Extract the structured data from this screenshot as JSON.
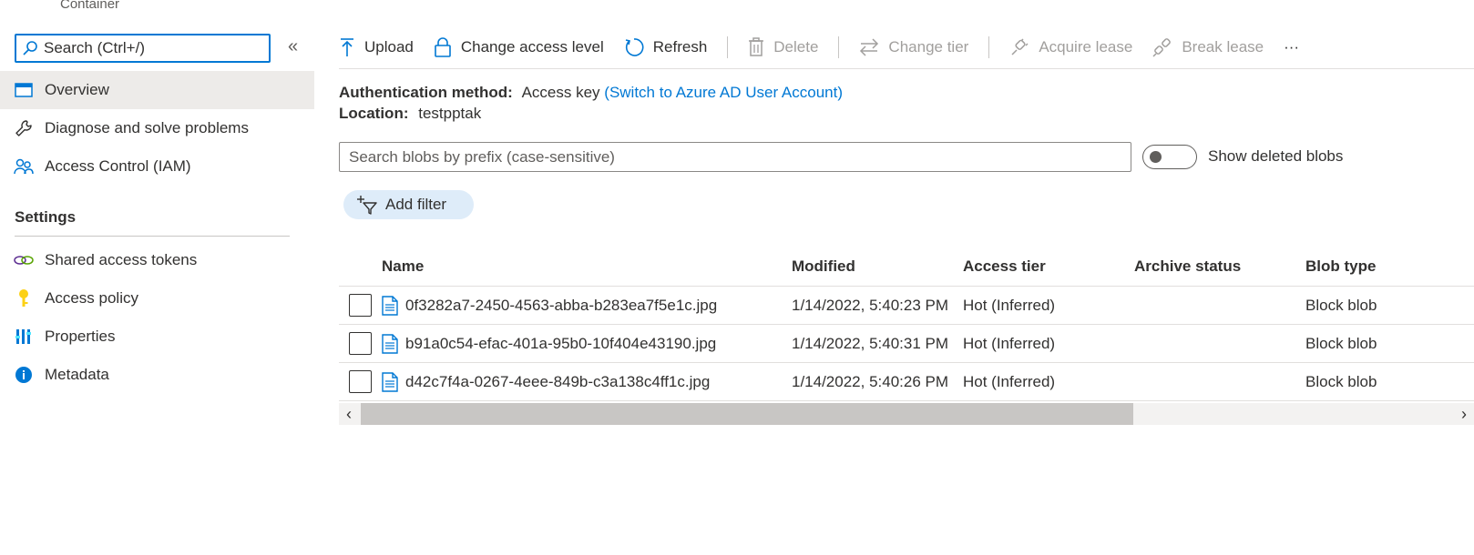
{
  "header": {
    "subtitle": "Container"
  },
  "sidebar": {
    "search_placeholder": "Search (Ctrl+/)",
    "collapse_glyph": "«",
    "items": [
      {
        "label": "Overview",
        "icon": "overview-icon",
        "selected": true
      },
      {
        "label": "Diagnose and solve problems",
        "icon": "wrench-icon"
      },
      {
        "label": "Access Control (IAM)",
        "icon": "people-icon"
      }
    ],
    "settings_label": "Settings",
    "settings_items": [
      {
        "label": "Shared access tokens",
        "icon": "link-chain-icon"
      },
      {
        "label": "Access policy",
        "icon": "key-icon"
      },
      {
        "label": "Properties",
        "icon": "properties-bars-icon"
      },
      {
        "label": "Metadata",
        "icon": "info-icon"
      }
    ]
  },
  "toolbar": {
    "upload": "Upload",
    "change_access_level": "Change access level",
    "refresh": "Refresh",
    "delete": "Delete",
    "change_tier": "Change tier",
    "acquire_lease": "Acquire lease",
    "break_lease": "Break lease",
    "more": "···"
  },
  "auth": {
    "method_label": "Authentication method:",
    "method_value": "Access key",
    "switch_link": "(Switch to Azure AD User Account)",
    "location_label": "Location:",
    "location_value": "testpptak"
  },
  "blob_search": {
    "placeholder": "Search blobs by prefix (case-sensitive)"
  },
  "show_deleted": {
    "label": "Show deleted blobs",
    "on": false
  },
  "filter": {
    "label": "Add filter"
  },
  "table": {
    "columns": [
      "Name",
      "Modified",
      "Access tier",
      "Archive status",
      "Blob type"
    ],
    "rows": [
      {
        "name": "0f3282a7-2450-4563-abba-b283ea7f5e1c.jpg",
        "modified": "1/14/2022, 5:40:23 PM",
        "tier": "Hot (Inferred)",
        "archive": "",
        "type": "Block blob"
      },
      {
        "name": "b91a0c54-efac-401a-95b0-10f404e43190.jpg",
        "modified": "1/14/2022, 5:40:31 PM",
        "tier": "Hot (Inferred)",
        "archive": "",
        "type": "Block blob"
      },
      {
        "name": "d42c7f4a-0267-4eee-849b-c3a138c4ff1c.jpg",
        "modified": "1/14/2022, 5:40:26 PM",
        "tier": "Hot (Inferred)",
        "archive": "",
        "type": "Block blob"
      }
    ]
  },
  "scrollbar": {
    "left_arrow": "‹",
    "right_arrow": "›"
  },
  "colors": {
    "accent": "#0078d4",
    "selected_bg": "#edebe9",
    "pill_bg": "#deecf9"
  }
}
